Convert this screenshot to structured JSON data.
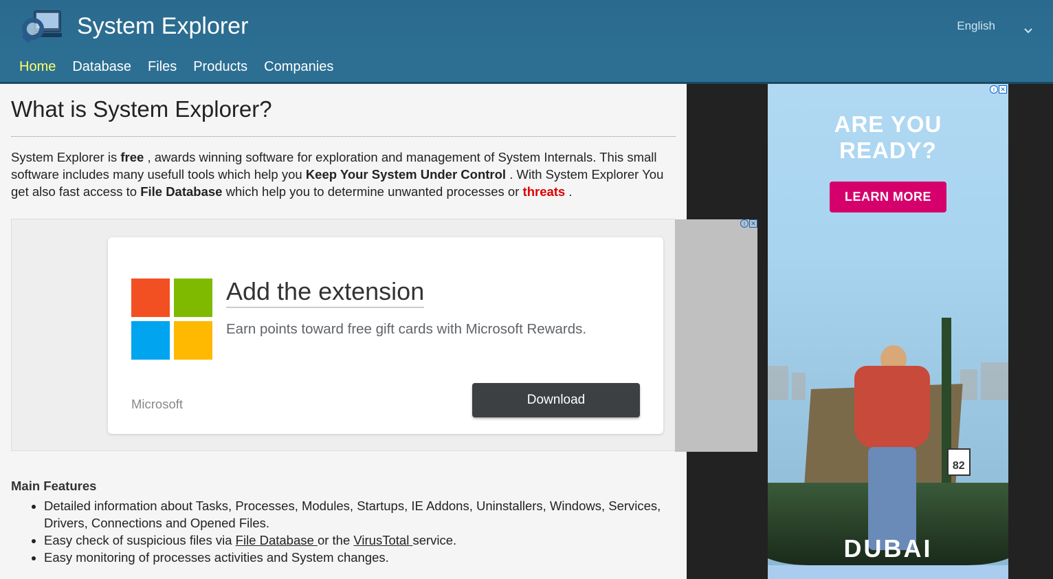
{
  "header": {
    "site_title": "System Explorer",
    "language": "English"
  },
  "nav": {
    "items": [
      {
        "label": "Home",
        "active": true
      },
      {
        "label": "Database",
        "active": false
      },
      {
        "label": "Files",
        "active": false
      },
      {
        "label": "Products",
        "active": false
      },
      {
        "label": "Companies",
        "active": false
      }
    ]
  },
  "page": {
    "heading": "What is System Explorer?",
    "intro": {
      "p1_a": "System Explorer is ",
      "p1_free": "free",
      "p1_b": " , awards winning software for exploration and management of System Internals. This small software includes many usefull tools which help you ",
      "p1_keep": "Keep Your System Under Control",
      "p1_c": " . With System Explorer You get also fast access to ",
      "p1_db": "File Database",
      "p1_d": " which help you to determine unwanted processes or ",
      "p1_threats": "threats",
      "p1_e": " ."
    },
    "features_heading": "Main Features",
    "features": [
      {
        "text_a": "Detailed information about Tasks, Processes, Modules, Startups, IE Addons, Uninstallers, Windows, Services, Drivers, Connections and Opened Files."
      },
      {
        "text_a": "Easy check of suspicious files via ",
        "link1": "File Database ",
        "text_b": "or the ",
        "link2": "VirusTotal ",
        "text_c": "service."
      },
      {
        "text_a": "Easy monitoring of processes activities and System changes."
      }
    ]
  },
  "inline_ad": {
    "headline": "Add the extension",
    "subtext": "Earn points toward free gift cards with Microsoft Rewards.",
    "brand": "Microsoft",
    "button": "Download"
  },
  "side_ad": {
    "title_line1": "ARE YOU",
    "title_line2": "READY?",
    "button": "LEARN MORE",
    "sign": "82",
    "logo": "DUBAI"
  }
}
